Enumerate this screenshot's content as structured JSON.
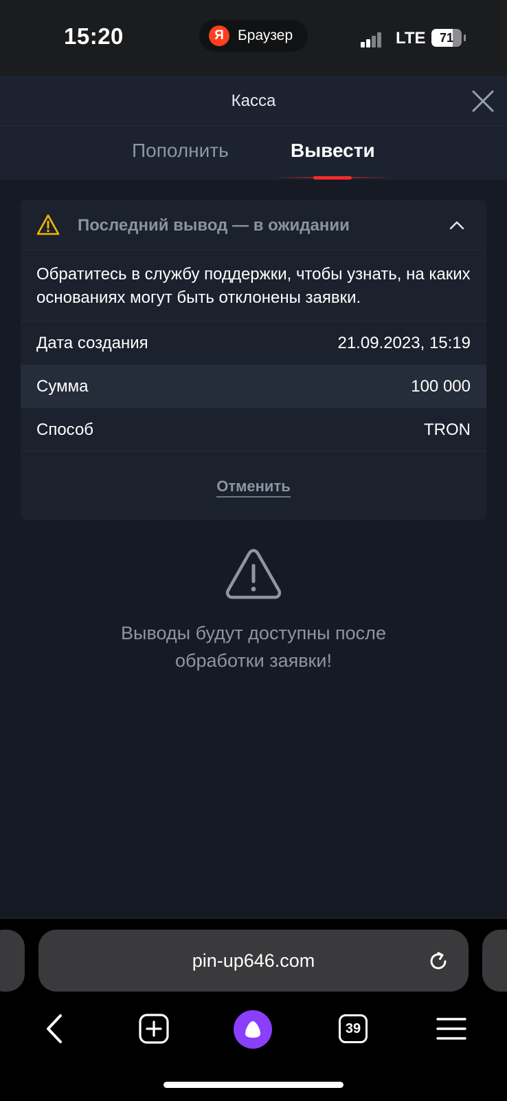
{
  "status_bar": {
    "time": "15:20",
    "app_logo": "Я",
    "app_label": "Браузер",
    "network": "LTE",
    "battery": "71",
    "battery_level": 0.71
  },
  "header": {
    "title": "Касса",
    "close_icon": "close-icon"
  },
  "tabs": [
    {
      "label": "Пополнить",
      "active": false
    },
    {
      "label": "Вывести",
      "active": true
    }
  ],
  "notice": {
    "title": "Последний вывод — в ожидании",
    "description": "Обратитесь в службу поддержки, чтобы узнать, на каких основаниях могут быть отклонены заявки.",
    "rows": [
      {
        "label": "Дата создания",
        "value": "21.09.2023, 15:19"
      },
      {
        "label": "Сумма",
        "value": "100 000"
      },
      {
        "label": "Способ",
        "value": "TRON"
      }
    ],
    "cancel_label": "Отменить",
    "warning_color": "#f5b800"
  },
  "info": {
    "message": "Выводы будут доступны после обработки заявки!"
  },
  "browser": {
    "url": "pin-up646.com",
    "tabs_count": "39"
  },
  "colors": {
    "background": "#151a24",
    "accent": "#f12c2c",
    "alice": "#8a3ffc"
  }
}
